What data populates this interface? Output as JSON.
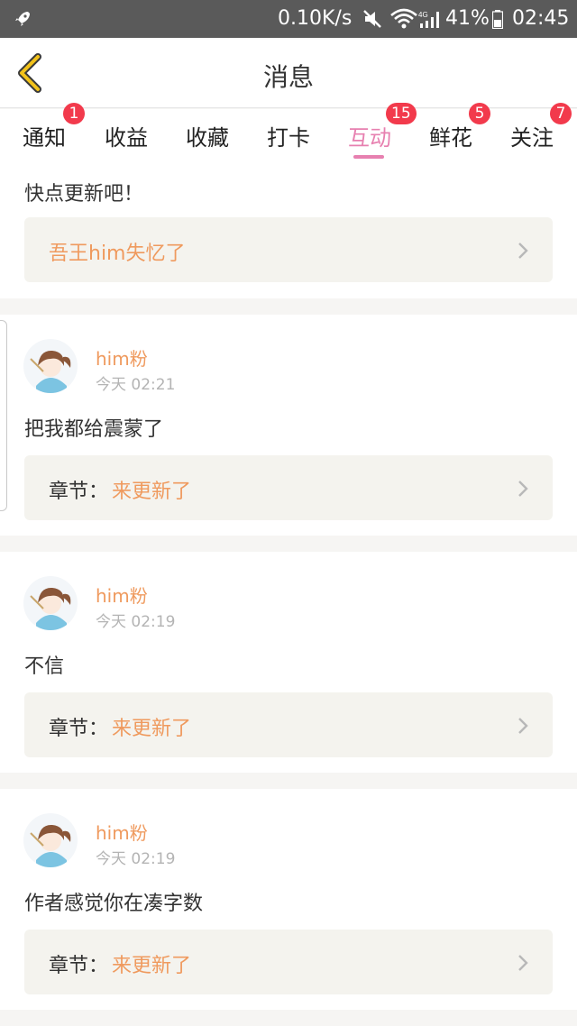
{
  "status_bar": {
    "net_speed": "0.10K/s",
    "battery_pct": "41%",
    "time": "02:45",
    "icons": [
      "rocket-icon",
      "mute-icon",
      "wifi-icon",
      "signal-4g-icon",
      "battery-icon"
    ]
  },
  "header": {
    "title": "消息",
    "back_icon": "back-chevron-icon",
    "accent": "#f2c21a"
  },
  "tabs": [
    {
      "label": "通知",
      "badge": "1"
    },
    {
      "label": "收益",
      "badge": ""
    },
    {
      "label": "收藏",
      "badge": ""
    },
    {
      "label": "打卡",
      "badge": ""
    },
    {
      "label": "互动",
      "badge": "15",
      "active": true
    },
    {
      "label": "鲜花",
      "badge": "5"
    },
    {
      "label": "关注",
      "badge": "7"
    }
  ],
  "messages": [
    {
      "comment": "快点更新吧！",
      "ref_value": "吾王him失忆了"
    },
    {
      "user": "him粉",
      "time": "今天 02:21",
      "comment": "把我都给震蒙了",
      "ref_label": "章节：",
      "ref_value": "来更新了"
    },
    {
      "user": "him粉",
      "time": "今天 02:19",
      "comment": "不信",
      "ref_label": "章节：",
      "ref_value": "来更新了"
    },
    {
      "user": "him粉",
      "time": "今天 02:19",
      "comment": "作者感觉你在凑字数",
      "ref_label": "章节：",
      "ref_value": "来更新了"
    }
  ],
  "colors": {
    "active_tab": "#e780b0",
    "badge": "#f23a4c",
    "username": "#ef9a5e",
    "link": "#ef9a5e",
    "ref_bg": "#f4f3ee"
  }
}
